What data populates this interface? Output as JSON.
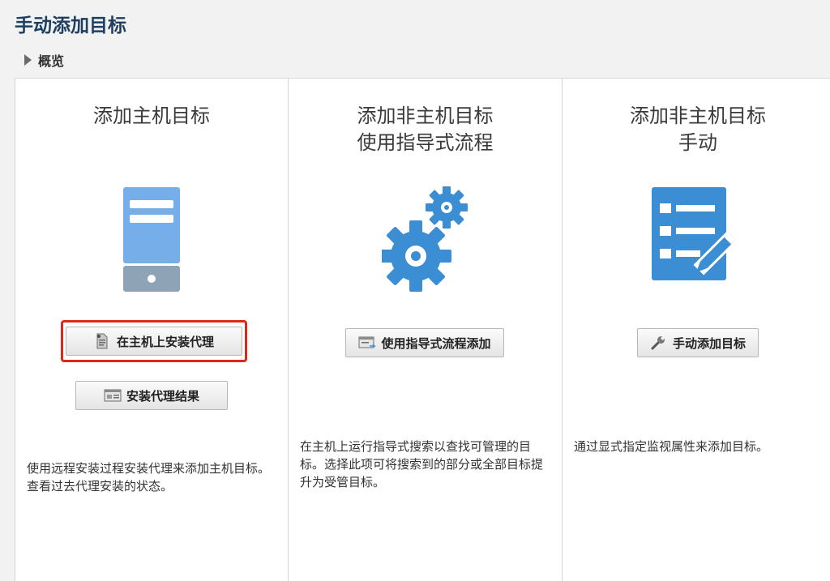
{
  "page": {
    "title": "手动添加目标"
  },
  "overview": {
    "label": "概览"
  },
  "panels": [
    {
      "title_lines": [
        "添加主机目标"
      ],
      "icon": "server-icon",
      "buttons": [
        {
          "label": "在主机上安装代理",
          "icon": "document-icon",
          "highlighted": true
        },
        {
          "label": "安装代理结果",
          "icon": "results-window-icon"
        }
      ],
      "description": "使用远程安装过程安装代理来添加主机目标。查看过去代理安装的状态。"
    },
    {
      "title_lines": [
        "添加非主机目标",
        "使用指导式流程"
      ],
      "icon": "gears-icon",
      "buttons": [
        {
          "label": "使用指导式流程添加",
          "icon": "wizard-icon"
        }
      ],
      "description": "在主机上运行指导式搜索以查找可管理的目标。选择此项可将搜索到的部分或全部目标提升为受管目标。"
    },
    {
      "title_lines": [
        "添加非主机目标",
        "手动"
      ],
      "icon": "list-edit-icon",
      "buttons": [
        {
          "label": "手动添加目标",
          "icon": "wrench-icon"
        }
      ],
      "description": "通过显式指定监视属性来添加目标。"
    }
  ],
  "colors": {
    "title": "#1f3f61",
    "icon_blue": "#3b8ed4",
    "highlight": "#e1261c"
  }
}
